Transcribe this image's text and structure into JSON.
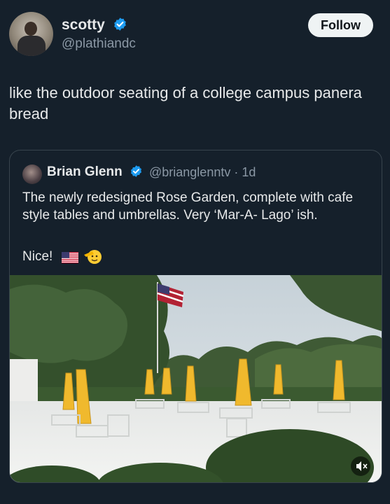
{
  "author": {
    "display_name": "scotty",
    "handle": "@plathiandc",
    "verified_icon": "verified-badge-icon"
  },
  "follow_label": "Follow",
  "tweet_text": "like the outdoor seating of a college campus panera bread",
  "quoted": {
    "display_name": "Brian Glenn",
    "handle_meta": "@brianglenntv · 1d",
    "text": "The newly redesigned Rose Garden, complete with cafe style tables and umbrellas. Very ‘Mar-A- Lago’ ish.",
    "text2": "Nice!",
    "emojis": [
      "us-flag-icon",
      "saluting-face-icon"
    ],
    "media_icon": "mute-icon"
  },
  "colors": {
    "background": "#15202b",
    "verified": "#1d9bf0",
    "text": "#e7e9ea",
    "muted_text": "#8b98a5",
    "follow_button": "#eff3f4"
  }
}
